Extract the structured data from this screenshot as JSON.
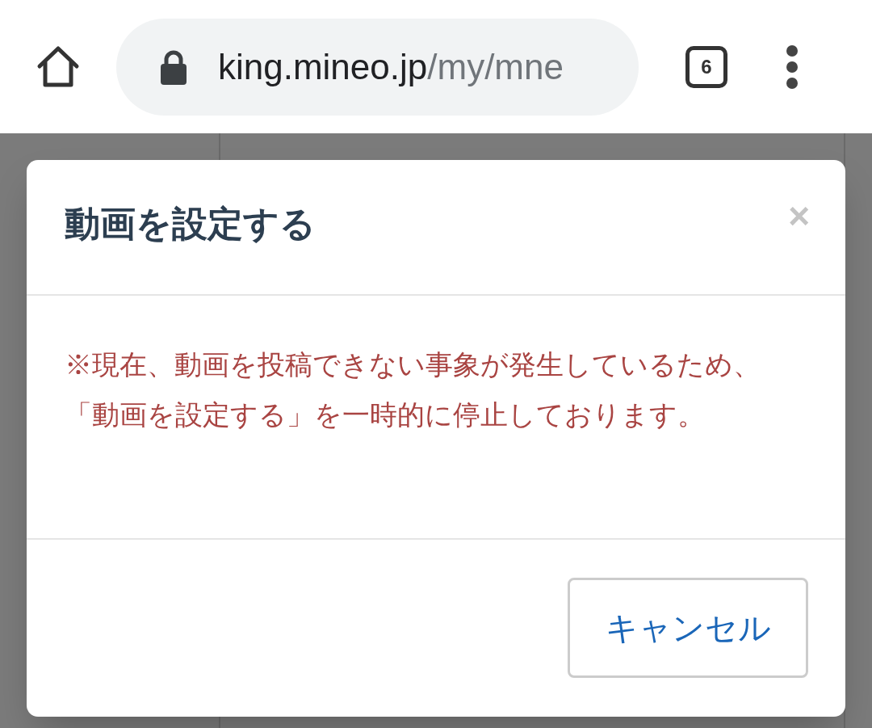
{
  "browser": {
    "url_host": "king.mineo.jp",
    "url_path": "/my/mne",
    "tab_count": "6"
  },
  "dialog": {
    "title": "動画を設定する",
    "close": "×",
    "message": "※現在、動画を投稿できない事象が発生しているため、「動画を設定する」を一時的に停止しております。",
    "buttons": [
      "キャンセル"
    ]
  }
}
